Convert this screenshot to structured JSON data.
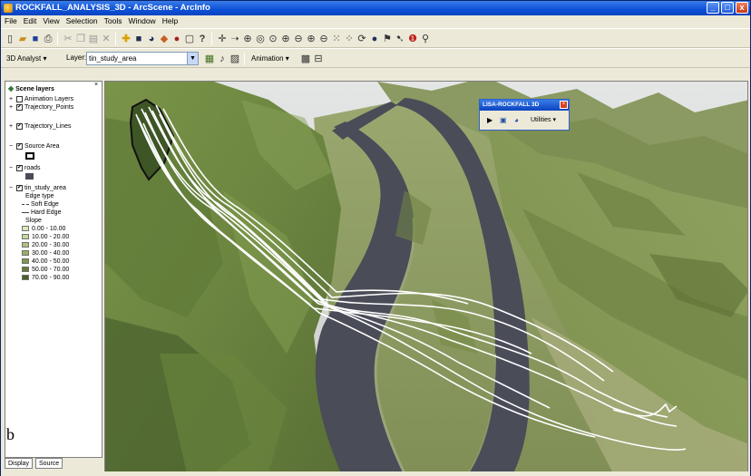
{
  "window": {
    "title": "ROCKFALL_ANALYSIS_3D - ArcScene - ArcInfo",
    "minimize": "_",
    "maximize": "□",
    "close": "x"
  },
  "menu": [
    "File",
    "Edit",
    "View",
    "Selection",
    "Tools",
    "Window",
    "Help"
  ],
  "toolbar2": {
    "analyst_label": "3D Analyst ▾",
    "layer_label": "Layer:",
    "layer_value": "tin_study_area",
    "animation_label": "Animation ▾"
  },
  "toc": {
    "title": "Scene layers",
    "layers": [
      {
        "name": "Animation Layers",
        "checked": false
      },
      {
        "name": "Trajectory_Points",
        "checked": true
      },
      {
        "name": "Trajectory_Lines",
        "checked": true
      },
      {
        "name": "Source Area",
        "checked": true
      },
      {
        "name": "roads",
        "checked": true
      },
      {
        "name": "tin_study_area",
        "checked": true
      }
    ],
    "tin_legend": {
      "edge_type": "Edge type",
      "soft": "Soft Edge",
      "hard": "Hard Edge",
      "slope": "Slope",
      "classes": [
        {
          "label": "0.00 - 10.00",
          "color": "#d8e8b8"
        },
        {
          "label": "10.00 - 20.00",
          "color": "#c4d89c"
        },
        {
          "label": "20.00 - 30.00",
          "color": "#aec47c"
        },
        {
          "label": "30.00 - 40.00",
          "color": "#98b064"
        },
        {
          "label": "40.00 - 50.00",
          "color": "#7e984c"
        },
        {
          "label": "50.00 - 70.00",
          "color": "#647c38"
        },
        {
          "label": "70.00 - 90.00",
          "color": "#4a6028"
        }
      ]
    },
    "panel_letter": "b",
    "tabs": [
      "Display",
      "Source"
    ]
  },
  "float_toolbar": {
    "title": "LISA-ROCKFALL 3D",
    "utilities": "Utilities ▾"
  },
  "colors": {
    "terrain_light": "#8a9f58",
    "terrain_dark": "#4f6330",
    "road": "#4a4c58",
    "trajectory": "#ffffff",
    "titlebar": "#0d50d8"
  }
}
